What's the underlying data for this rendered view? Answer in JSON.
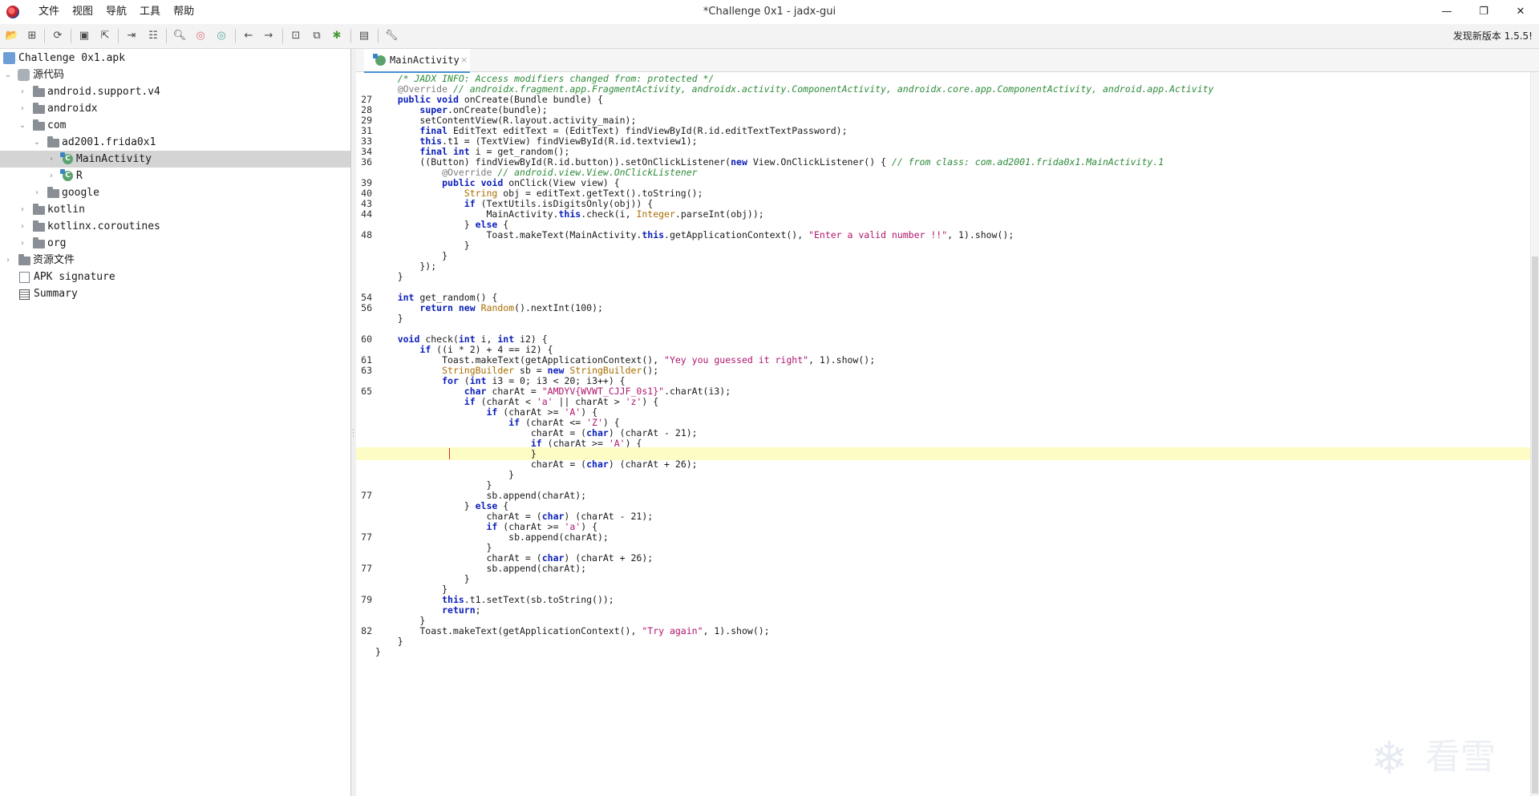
{
  "window": {
    "title": "*Challenge 0x1 - jadx-gui",
    "menu": [
      "文件",
      "视图",
      "导航",
      "工具",
      "帮助"
    ],
    "minimize": "—",
    "maximize": "❐",
    "close": "✕",
    "update_notice": "发现新版本 1.5.5!"
  },
  "toolbar": {
    "icons": [
      "open-file-icon",
      "add-files-icon",
      "sync-icon",
      "save-icon",
      "export-icon",
      "sync-editor-icon",
      "flatten-icon",
      "search-icon",
      "class-search-icon",
      "usage-search-icon",
      "back-icon",
      "forward-icon",
      "quark-icon",
      "deobfuscation-icon",
      "debug-icon",
      "log-icon",
      "preferences-icon"
    ]
  },
  "tree": {
    "root": "Challenge 0x1.apk",
    "items": [
      {
        "label": "源代码",
        "type": "source"
      },
      {
        "label": "android.support.v4",
        "type": "package"
      },
      {
        "label": "androidx",
        "type": "package"
      },
      {
        "label": "com",
        "type": "package"
      },
      {
        "label": "ad2001.frida0x1",
        "type": "package"
      },
      {
        "label": "MainActivity",
        "type": "class"
      },
      {
        "label": "R",
        "type": "class"
      },
      {
        "label": "google",
        "type": "package"
      },
      {
        "label": "kotlin",
        "type": "package"
      },
      {
        "label": "kotlinx.coroutines",
        "type": "package"
      },
      {
        "label": "org",
        "type": "package"
      },
      {
        "label": "资源文件",
        "type": "resources"
      },
      {
        "label": "APK signature",
        "type": "signature"
      },
      {
        "label": "Summary",
        "type": "summary"
      }
    ]
  },
  "editor": {
    "tab_label": "MainActivity",
    "tab_close": "×",
    "code": [
      {
        "n": "",
        "t": "    /* JADX INFO: Access modifiers changed from: protected */"
      },
      {
        "n": "",
        "t": "    @Override // androidx.fragment.app.FragmentActivity, androidx.activity.ComponentActivity, androidx.core.app.ComponentActivity, android.app.Activity"
      },
      {
        "n": "27",
        "t": "    public void onCreate(Bundle bundle) {"
      },
      {
        "n": "28",
        "t": "        super.onCreate(bundle);"
      },
      {
        "n": "29",
        "t": "        setContentView(R.layout.activity_main);"
      },
      {
        "n": "31",
        "t": "        final EditText editText = (EditText) findViewById(R.id.editTextTextPassword);"
      },
      {
        "n": "33",
        "t": "        this.t1 = (TextView) findViewById(R.id.textview1);"
      },
      {
        "n": "34",
        "t": "        final int i = get_random();"
      },
      {
        "n": "36",
        "t": "        ((Button) findViewById(R.id.button)).setOnClickListener(new View.OnClickListener() { // from class: com.ad2001.frida0x1.MainActivity.1"
      },
      {
        "n": "",
        "t": "            @Override // android.view.View.OnClickListener"
      },
      {
        "n": "39",
        "t": "            public void onClick(View view) {"
      },
      {
        "n": "40",
        "t": "                String obj = editText.getText().toString();"
      },
      {
        "n": "43",
        "t": "                if (TextUtils.isDigitsOnly(obj)) {"
      },
      {
        "n": "44",
        "t": "                    MainActivity.this.check(i, Integer.parseInt(obj));"
      },
      {
        "n": "",
        "t": "                } else {"
      },
      {
        "n": "48",
        "t": "                    Toast.makeText(MainActivity.this.getApplicationContext(), \"Enter a valid number !!\", 1).show();"
      },
      {
        "n": "",
        "t": "                }"
      },
      {
        "n": "",
        "t": "            }"
      },
      {
        "n": "",
        "t": "        });"
      },
      {
        "n": "",
        "t": "    }"
      },
      {
        "n": "",
        "t": ""
      },
      {
        "n": "54",
        "t": "    int get_random() {"
      },
      {
        "n": "56",
        "t": "        return new Random().nextInt(100);"
      },
      {
        "n": "",
        "t": "    }"
      },
      {
        "n": "",
        "t": ""
      },
      {
        "n": "60",
        "t": "    void check(int i, int i2) {"
      },
      {
        "n": "",
        "t": "        if ((i * 2) + 4 == i2) {"
      },
      {
        "n": "61",
        "t": "            Toast.makeText(getApplicationContext(), \"Yey you guessed it right\", 1).show();"
      },
      {
        "n": "63",
        "t": "            StringBuilder sb = new StringBuilder();"
      },
      {
        "n": "",
        "t": "            for (int i3 = 0; i3 < 20; i3++) {"
      },
      {
        "n": "65",
        "t": "                char charAt = \"AMDYV{WVWT_CJJF_0s1}\".charAt(i3);"
      },
      {
        "n": "",
        "t": "                if (charAt < 'a' || charAt > 'z') {"
      },
      {
        "n": "",
        "t": "                    if (charAt >= 'A') {"
      },
      {
        "n": "",
        "t": "                        if (charAt <= 'Z') {"
      },
      {
        "n": "",
        "t": "                            charAt = (char) (charAt - 21);"
      },
      {
        "n": "",
        "t": "                            if (charAt >= 'A') {"
      },
      {
        "n": "",
        "t": "                            }"
      },
      {
        "n": "",
        "t": "                            charAt = (char) (charAt + 26);"
      },
      {
        "n": "",
        "t": "                        }"
      },
      {
        "n": "",
        "t": "                    }"
      },
      {
        "n": "77",
        "t": "                    sb.append(charAt);"
      },
      {
        "n": "",
        "t": "                } else {"
      },
      {
        "n": "",
        "t": "                    charAt = (char) (charAt - 21);"
      },
      {
        "n": "",
        "t": "                    if (charAt >= 'a') {"
      },
      {
        "n": "77",
        "t": "                        sb.append(charAt);"
      },
      {
        "n": "",
        "t": "                    }"
      },
      {
        "n": "",
        "t": "                    charAt = (char) (charAt + 26);"
      },
      {
        "n": "77",
        "t": "                    sb.append(charAt);"
      },
      {
        "n": "",
        "t": "                }"
      },
      {
        "n": "",
        "t": "            }"
      },
      {
        "n": "79",
        "t": "            this.t1.setText(sb.toString());"
      },
      {
        "n": "",
        "t": "            return;"
      },
      {
        "n": "",
        "t": "        }"
      },
      {
        "n": "82",
        "t": "        Toast.makeText(getApplicationContext(), \"Try again\", 1).show();"
      },
      {
        "n": "",
        "t": "    }"
      },
      {
        "n": "",
        "t": "}"
      }
    ]
  },
  "watermark": {
    "text": "看雪"
  }
}
